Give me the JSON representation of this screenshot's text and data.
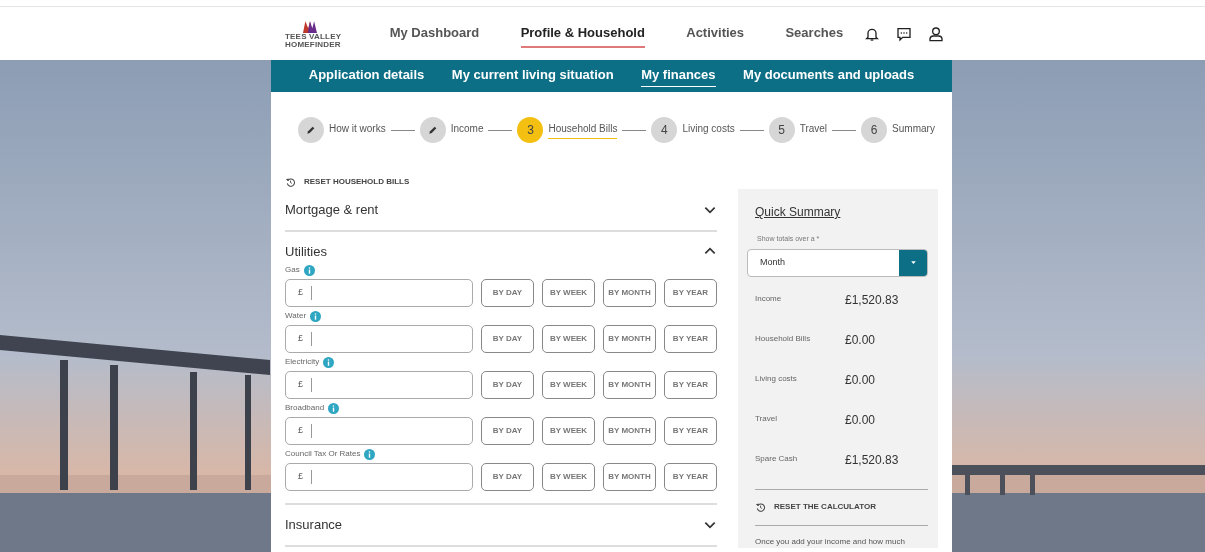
{
  "header": {
    "logo_lines": [
      "TEES VALLEY",
      "HOMEFINDER"
    ],
    "nav": [
      {
        "label": "My Dashboard",
        "selected": false
      },
      {
        "label": "Profile & Household",
        "selected": true
      },
      {
        "label": "Activities",
        "selected": false
      },
      {
        "label": "Searches",
        "selected": false
      }
    ]
  },
  "subnav": [
    {
      "label": "Application details",
      "selected": false
    },
    {
      "label": "My current living situation",
      "selected": false
    },
    {
      "label": "My finances",
      "selected": true
    },
    {
      "label": "My documents and uploads",
      "selected": false
    }
  ],
  "steps": [
    {
      "kind": "done",
      "label": "How it works"
    },
    {
      "kind": "done",
      "label": "Income"
    },
    {
      "kind": "current",
      "number": "3",
      "label": "Household Bills"
    },
    {
      "kind": "todo",
      "number": "4",
      "label": "Living costs"
    },
    {
      "kind": "todo",
      "number": "5",
      "label": "Travel"
    },
    {
      "kind": "todo",
      "number": "6",
      "label": "Summary"
    }
  ],
  "reset_link": "RESET HOUSEHOLD BILLS",
  "sections": [
    {
      "title": "Mortgage & rent",
      "expanded": false
    },
    {
      "title": "Utilities",
      "expanded": true,
      "fields": [
        {
          "label": "Gas",
          "prefix": "£",
          "buttons": [
            "BY DAY",
            "BY WEEK",
            "BY MONTH",
            "BY YEAR"
          ]
        },
        {
          "label": "Water",
          "prefix": "£",
          "buttons": [
            "BY DAY",
            "BY WEEK",
            "BY MONTH",
            "BY YEAR"
          ]
        },
        {
          "label": "Electricity",
          "prefix": "£",
          "buttons": [
            "BY DAY",
            "BY WEEK",
            "BY MONTH",
            "BY YEAR"
          ]
        },
        {
          "label": "Broadband",
          "prefix": "£",
          "buttons": [
            "BY DAY",
            "BY WEEK",
            "BY MONTH",
            "BY YEAR"
          ]
        },
        {
          "label": "Council Tax Or Rates",
          "prefix": "£",
          "buttons": [
            "BY DAY",
            "BY WEEK",
            "BY MONTH",
            "BY YEAR"
          ]
        }
      ]
    },
    {
      "title": "Insurance",
      "expanded": false
    }
  ],
  "summary": {
    "title": "Quick Summary",
    "select_label": "Show totals over a *",
    "select_value": "Month",
    "rows": [
      {
        "label": "Income",
        "value": "£1,520.83"
      },
      {
        "label": "Household Bills",
        "value": "£0.00"
      },
      {
        "label": "Living costs",
        "value": "£0.00"
      },
      {
        "label": "Travel",
        "value": "£0.00"
      },
      {
        "label": "Spare Cash",
        "value": "£1,520.83"
      }
    ],
    "reset_link": "RESET THE CALCULATOR",
    "note": "Once you add your income and how much"
  }
}
